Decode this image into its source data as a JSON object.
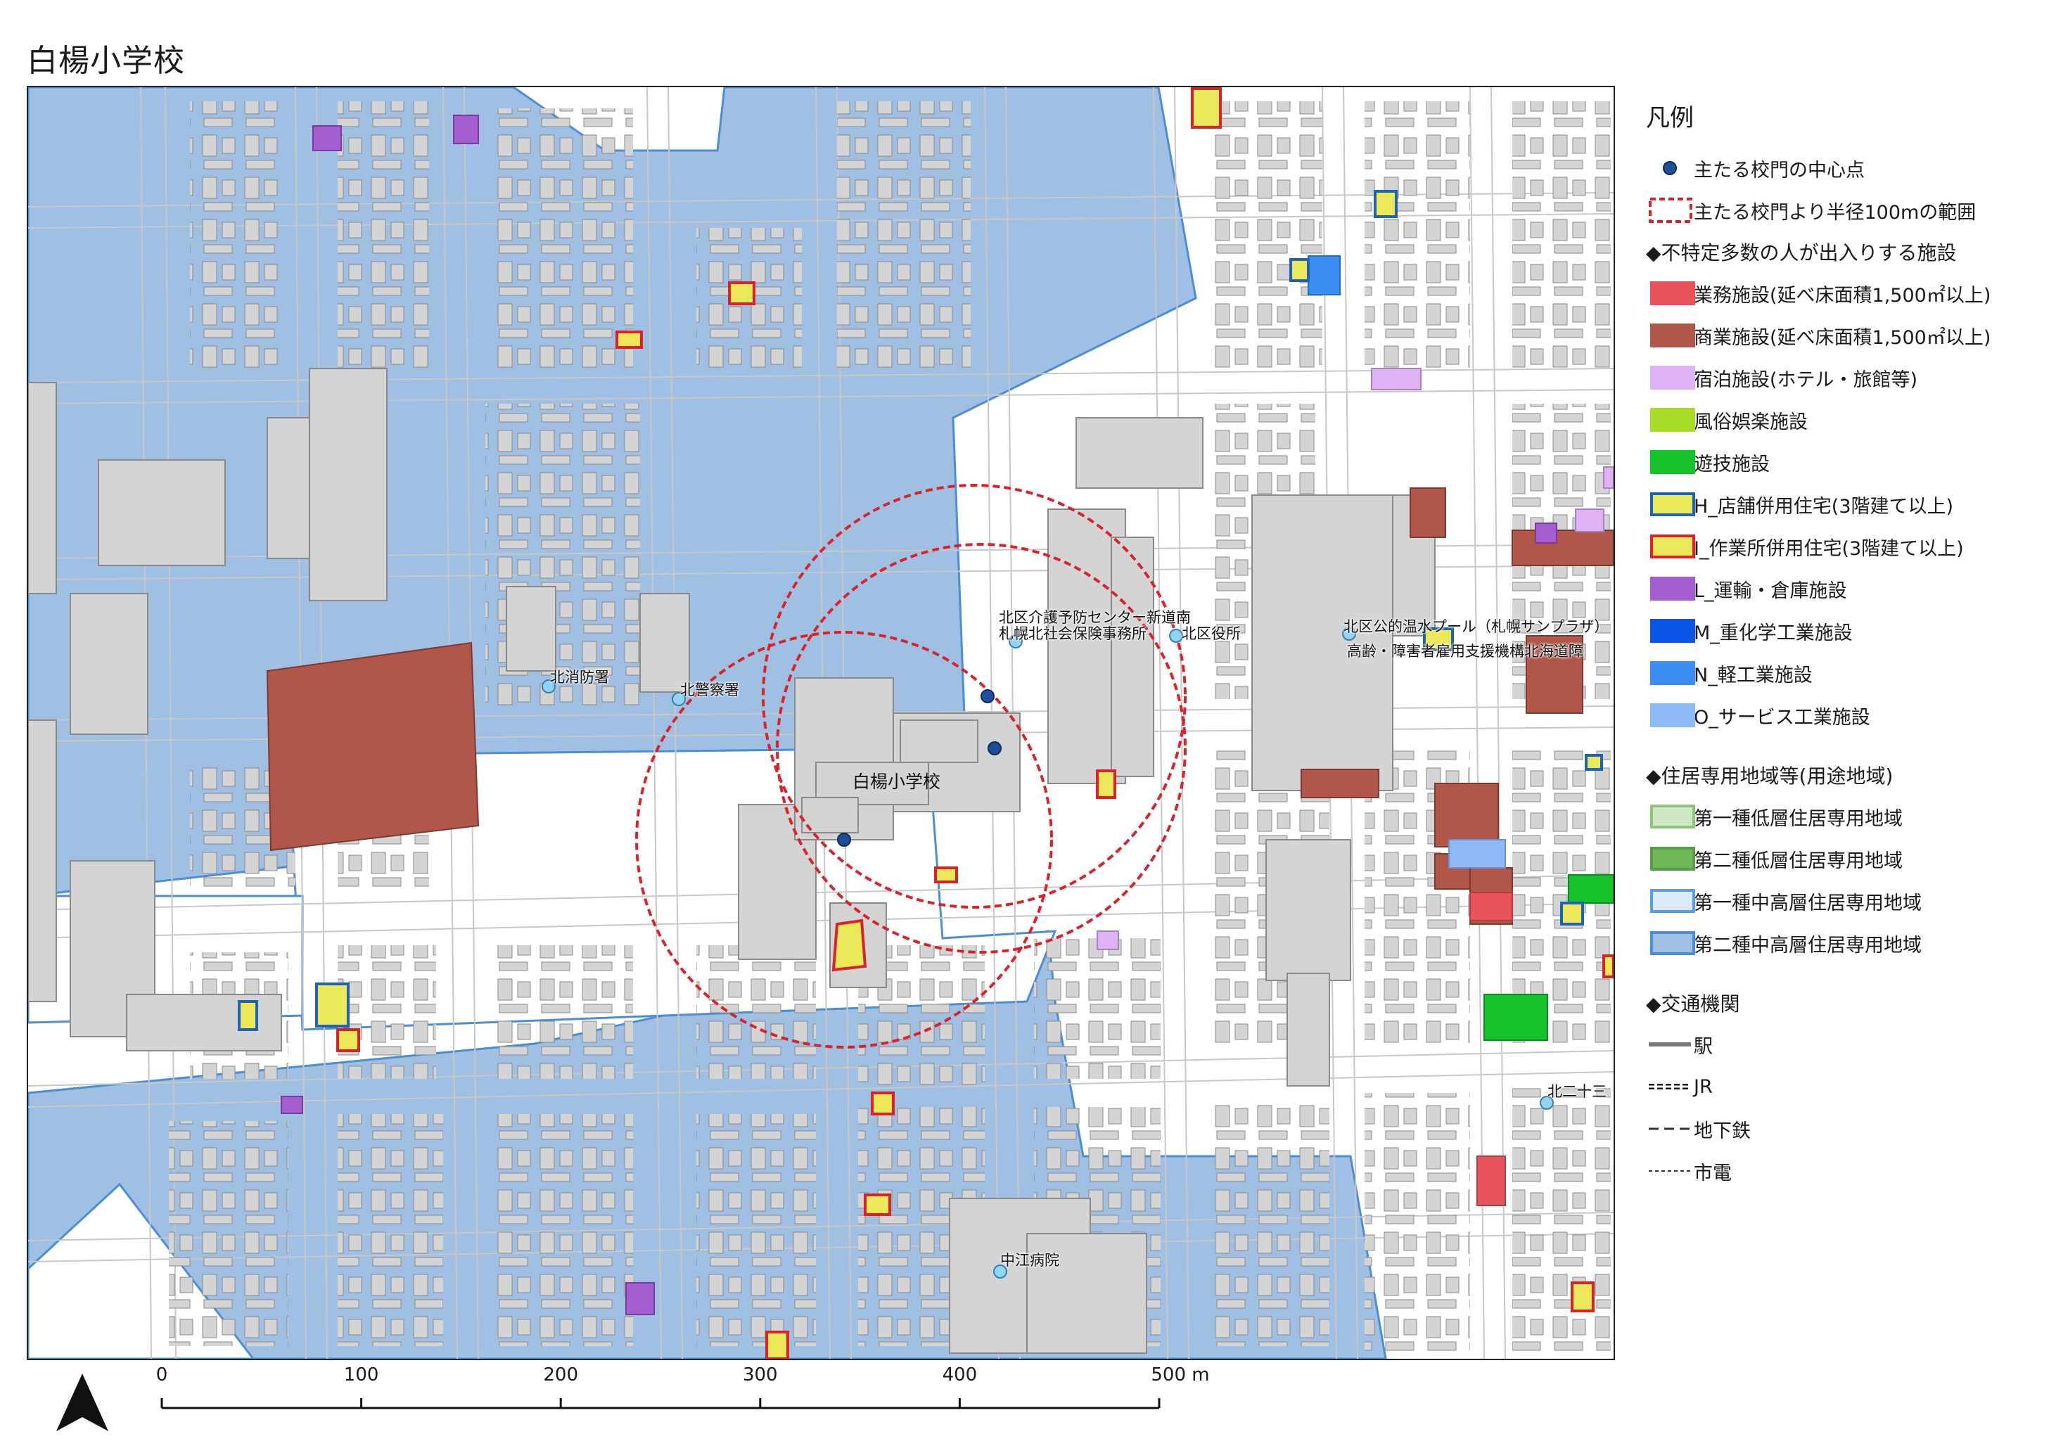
{
  "title": "白楊小学校",
  "map": {
    "school_label": "白楊小学校",
    "poi_labels": [
      "北消防署",
      "北警察署",
      "北区介護予防センター新道南",
      "札幌北社会保険事務所",
      "北区役所",
      "北区公的温水プール（札幌サンプラザ）",
      "高齢・障害者雇用支援機構北海道障",
      "中江病院",
      "北二十三"
    ]
  },
  "legend": {
    "title": "凡例",
    "gate_point": "主たる校門の中心点",
    "radius_range": "主たる校門より半径100mの範囲",
    "facilities_heading": "◆不特定多数の人が出入りする施設",
    "facility_items": [
      {
        "label": "業務施設(延べ床面積1,500㎡以上)",
        "fill": "#e8525a",
        "stroke": "#e8525a"
      },
      {
        "label": "商業施設(延べ床面積1,500㎡以上)",
        "fill": "#b0574a",
        "stroke": "#b0574a"
      },
      {
        "label": "宿泊施設(ホテル・旅館等)",
        "fill": "#dfb2f3",
        "stroke": "#dfb2f3"
      },
      {
        "label": "風俗娯楽施設",
        "fill": "#a9dd2a",
        "stroke": "#a9dd2a"
      },
      {
        "label": "遊技施設",
        "fill": "#16c22a",
        "stroke": "#16c22a"
      },
      {
        "label": "H_店舗併用住宅(3階建て以上)",
        "fill": "#ebe85a",
        "stroke": "#1f63b6"
      },
      {
        "label": "I_作業所併用住宅(3階建て以上)",
        "fill": "#ebe85a",
        "stroke": "#d8232a"
      },
      {
        "label": "L_運輸・倉庫施設",
        "fill": "#a55ed0",
        "stroke": "#a55ed0"
      },
      {
        "label": "M_重化学工業施設",
        "fill": "#0a54e6",
        "stroke": "#0a54e6"
      },
      {
        "label": "N_軽工業施設",
        "fill": "#3b8ef2",
        "stroke": "#3b8ef2"
      },
      {
        "label": "O_サービス工業施設",
        "fill": "#8db9f5",
        "stroke": "#8db9f5"
      }
    ],
    "zoning_heading": "◆住居専用地域等(用途地域)",
    "zoning_items": [
      {
        "label": "第一種低層住居専用地域",
        "fill": "#cfe8c3",
        "stroke": "#8fc27a"
      },
      {
        "label": "第二種低層住居専用地域",
        "fill": "#6fb85a",
        "stroke": "#5a9c48"
      },
      {
        "label": "第一種中高層住居専用地域",
        "fill": "#dce9f7",
        "stroke": "#5a9ee0"
      },
      {
        "label": "第二種中高層住居専用地域",
        "fill": "#9fbfe3",
        "stroke": "#4a8ed6"
      }
    ],
    "transport_heading": "◆交通機関",
    "transport_items": [
      {
        "label": "駅",
        "style": "station"
      },
      {
        "label": "JR",
        "style": "jr"
      },
      {
        "label": "地下鉄",
        "style": "subway"
      },
      {
        "label": "市電",
        "style": "tram"
      }
    ]
  },
  "scale_bar": {
    "ticks": [
      "0",
      "100",
      "200",
      "300",
      "400",
      "500 m"
    ]
  },
  "colors": {
    "zone_blue": "#9fbfe3",
    "building_gray": "#d4d4d4",
    "radius_red": "#d8232a",
    "gate_blue": "#1f4e9c",
    "poi_cyan": "#8fd4f2"
  }
}
